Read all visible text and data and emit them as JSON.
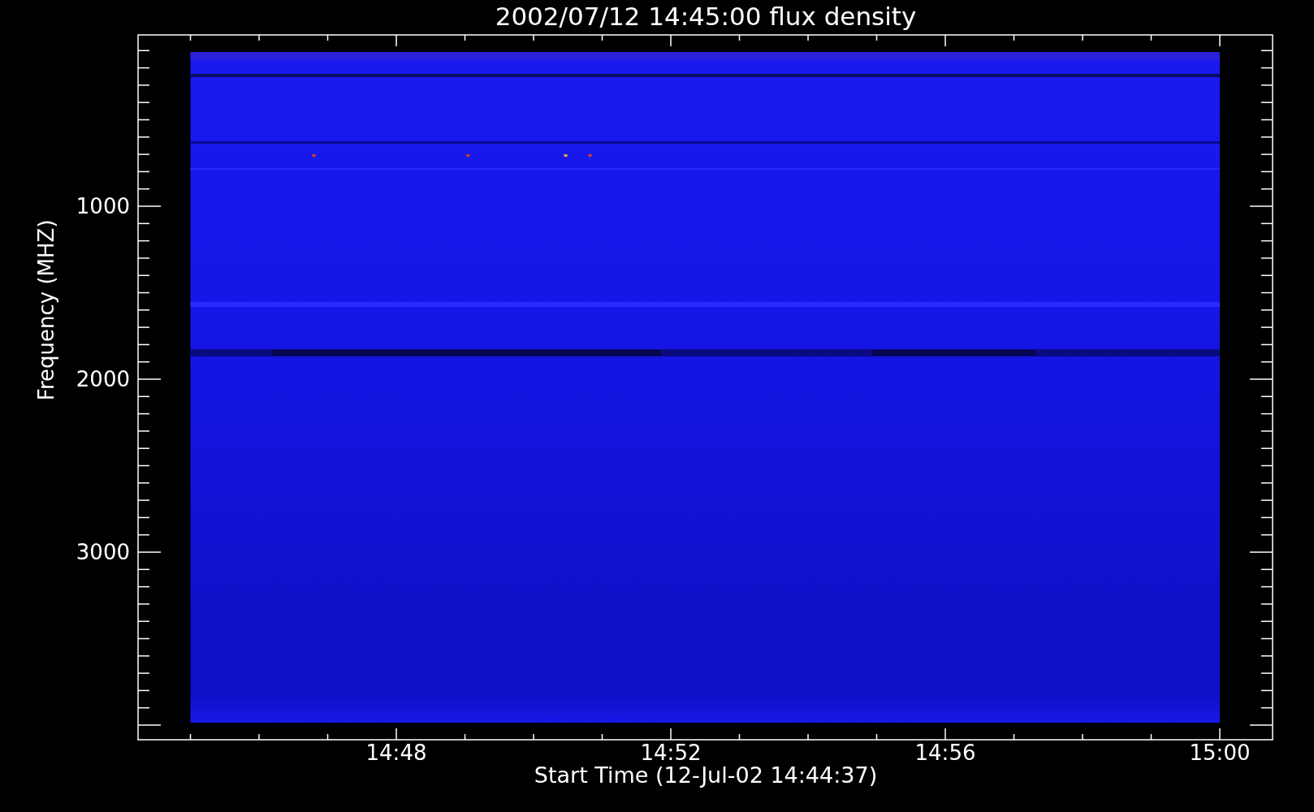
{
  "title": "2002/07/12 14:45:00 flux density",
  "x_axis": {
    "label": "Start Time (12-Jul-02 14:44:37)",
    "ticks": [
      "14:48",
      "14:52",
      "14:56",
      "15:00"
    ]
  },
  "y_axis": {
    "label": "Frequency (MHZ)",
    "ticks": [
      "1000",
      "2000",
      "3000"
    ]
  }
}
